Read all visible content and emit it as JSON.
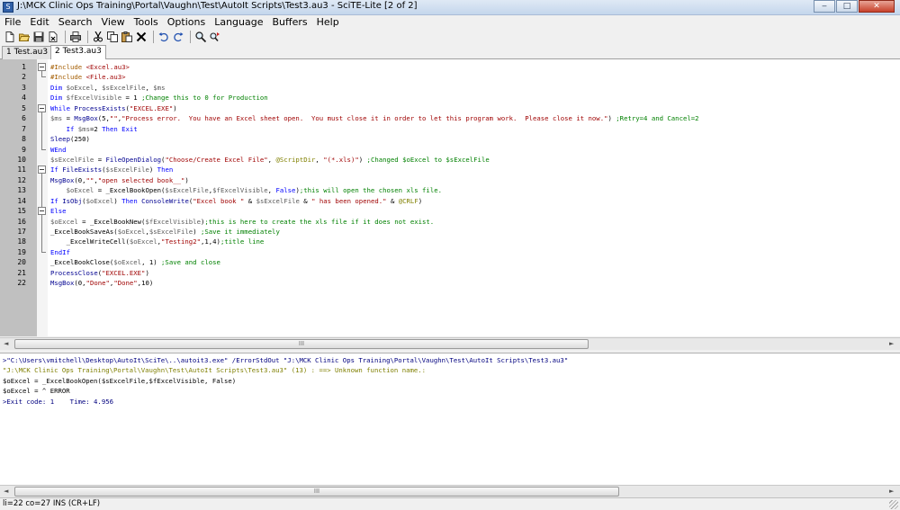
{
  "window": {
    "title": "J:\\MCK Clinic Ops Training\\Portal\\Vaughn\\Test\\AutoIt Scripts\\Test3.au3 - SciTE-Lite [2 of 2]",
    "minimize": "‒",
    "maximize": "□",
    "close": "✕"
  },
  "menu": [
    "File",
    "Edit",
    "Search",
    "View",
    "Tools",
    "Options",
    "Language",
    "Buffers",
    "Help"
  ],
  "toolbar_icons": [
    "new-file-icon",
    "open-folder-icon",
    "save-icon",
    "close-file-icon",
    "print-icon",
    "cut-icon",
    "copy-icon",
    "paste-icon",
    "delete-icon",
    "undo-icon",
    "redo-icon",
    "find-icon",
    "replace-icon"
  ],
  "tabs": [
    {
      "label": "1 Test.au3 *",
      "active": false
    },
    {
      "label": "2 Test3.au3",
      "active": true
    }
  ],
  "colors": {
    "keyword": "#0000ff",
    "string": "#9f0000",
    "comment": "#008000",
    "include": "#a45d00",
    "variable": "#5a5a5a",
    "func": "#000090",
    "macro": "#808000",
    "default": "#000000",
    "out_cmd": "#00007f",
    "out_error": "#7f7f00",
    "out_normal": "#000000"
  },
  "code_lines": [
    {
      "n": "1",
      "fold": "box-start",
      "tokens": [
        [
          "include",
          "#Include"
        ],
        [
          "default",
          " "
        ],
        [
          "string",
          "<Excel.au3>"
        ]
      ]
    },
    {
      "n": "2",
      "fold": "end",
      "tokens": [
        [
          "include",
          "#Include"
        ],
        [
          "default",
          " "
        ],
        [
          "string",
          "<File.au3>"
        ]
      ]
    },
    {
      "n": "3",
      "fold": "",
      "tokens": [
        [
          "keyword",
          "Dim"
        ],
        [
          "default",
          " "
        ],
        [
          "variable",
          "$oExcel"
        ],
        [
          "default",
          ", "
        ],
        [
          "variable",
          "$sExcelFile"
        ],
        [
          "default",
          ", "
        ],
        [
          "variable",
          "$ms"
        ]
      ]
    },
    {
      "n": "4",
      "fold": "",
      "tokens": [
        [
          "keyword",
          "Dim"
        ],
        [
          "default",
          " "
        ],
        [
          "variable",
          "$fExcelVisible"
        ],
        [
          "default",
          " = 1 "
        ],
        [
          "comment",
          ";Change this to 0 for Production"
        ]
      ]
    },
    {
      "n": "5",
      "fold": "box-start",
      "tokens": [
        [
          "keyword",
          "While"
        ],
        [
          "default",
          " "
        ],
        [
          "func",
          "ProcessExists"
        ],
        [
          "default",
          "("
        ],
        [
          "string",
          "\"EXCEL.EXE\""
        ],
        [
          "default",
          ")"
        ]
      ]
    },
    {
      "n": "6",
      "fold": "line",
      "tokens": [
        [
          "variable",
          "$ms"
        ],
        [
          "default",
          " = "
        ],
        [
          "func",
          "MsgBox"
        ],
        [
          "default",
          "(5,"
        ],
        [
          "string",
          "\"\""
        ],
        [
          "default",
          ","
        ],
        [
          "string",
          "\"Process error.  You have an Excel sheet open.  You must close it in order to let this program work.  Please close it now.\""
        ],
        [
          "default",
          ") "
        ],
        [
          "comment",
          ";Retry=4 and Cancel=2"
        ]
      ]
    },
    {
      "n": "7",
      "fold": "line",
      "tokens": [
        [
          "default",
          "    "
        ],
        [
          "keyword",
          "If"
        ],
        [
          "default",
          " "
        ],
        [
          "variable",
          "$ms"
        ],
        [
          "default",
          "=2 "
        ],
        [
          "keyword",
          "Then"
        ],
        [
          "default",
          " "
        ],
        [
          "keyword",
          "Exit"
        ]
      ]
    },
    {
      "n": "8",
      "fold": "line",
      "tokens": [
        [
          "func",
          "Sleep"
        ],
        [
          "default",
          "(250)"
        ]
      ]
    },
    {
      "n": "9",
      "fold": "end",
      "tokens": [
        [
          "keyword",
          "WEnd"
        ]
      ]
    },
    {
      "n": "10",
      "fold": "",
      "tokens": [
        [
          "variable",
          "$sExcelFile"
        ],
        [
          "default",
          " = "
        ],
        [
          "func",
          "FileOpenDialog"
        ],
        [
          "default",
          "("
        ],
        [
          "string",
          "\"Choose/Create Excel File\""
        ],
        [
          "default",
          ", "
        ],
        [
          "macro",
          "@ScriptDir"
        ],
        [
          "default",
          ", "
        ],
        [
          "string",
          "\"(*.xls)\""
        ],
        [
          "default",
          ") "
        ],
        [
          "comment",
          ";Changed $oExcel to $sExcelFile"
        ]
      ]
    },
    {
      "n": "11",
      "fold": "box-start",
      "tokens": [
        [
          "keyword",
          "If"
        ],
        [
          "default",
          " "
        ],
        [
          "func",
          "FileExists"
        ],
        [
          "default",
          "("
        ],
        [
          "variable",
          "$sExcelFile"
        ],
        [
          "default",
          ") "
        ],
        [
          "keyword",
          "Then"
        ]
      ]
    },
    {
      "n": "12",
      "fold": "line",
      "tokens": [
        [
          "func",
          "MsgBox"
        ],
        [
          "default",
          "(0,"
        ],
        [
          "string",
          "\"\""
        ],
        [
          "default",
          ","
        ],
        [
          "string",
          "\"open selected book__\""
        ],
        [
          "default",
          ")"
        ]
      ]
    },
    {
      "n": "13",
      "fold": "line",
      "tokens": [
        [
          "default",
          "    "
        ],
        [
          "variable",
          "$oExcel"
        ],
        [
          "default",
          " = _ExcelBookOpen("
        ],
        [
          "variable",
          "$sExcelFile"
        ],
        [
          "default",
          ","
        ],
        [
          "variable",
          "$fExcelVisible"
        ],
        [
          "default",
          ", "
        ],
        [
          "keyword",
          "False"
        ],
        [
          "default",
          ")"
        ],
        [
          "comment",
          ";this will open the chosen xls file."
        ]
      ]
    },
    {
      "n": "14",
      "fold": "line",
      "tokens": [
        [
          "keyword",
          "If"
        ],
        [
          "default",
          " "
        ],
        [
          "func",
          "IsObj"
        ],
        [
          "default",
          "("
        ],
        [
          "variable",
          "$oExcel"
        ],
        [
          "default",
          ") "
        ],
        [
          "keyword",
          "Then"
        ],
        [
          "default",
          " "
        ],
        [
          "func",
          "ConsoleWrite"
        ],
        [
          "default",
          "("
        ],
        [
          "string",
          "\"Excel book \""
        ],
        [
          "default",
          " & "
        ],
        [
          "variable",
          "$sExcelFile"
        ],
        [
          "default",
          " & "
        ],
        [
          "string",
          "\" has been opened.\""
        ],
        [
          "default",
          " & "
        ],
        [
          "macro",
          "@CRLF"
        ],
        [
          "default",
          ")"
        ]
      ]
    },
    {
      "n": "15",
      "fold": "box-mid",
      "tokens": [
        [
          "keyword",
          "Else"
        ]
      ]
    },
    {
      "n": "16",
      "fold": "line",
      "tokens": [
        [
          "variable",
          "$oExcel"
        ],
        [
          "default",
          " = _ExcelBookNew("
        ],
        [
          "variable",
          "$fExcelVisible"
        ],
        [
          "default",
          ")"
        ],
        [
          "comment",
          ";this is here to create the xls file if it does not exist."
        ]
      ]
    },
    {
      "n": "17",
      "fold": "line",
      "tokens": [
        [
          "default",
          "_ExcelBookSaveAs("
        ],
        [
          "variable",
          "$oExcel"
        ],
        [
          "default",
          ","
        ],
        [
          "variable",
          "$sExcelFile"
        ],
        [
          "default",
          ") "
        ],
        [
          "comment",
          ";Save it immediately"
        ]
      ]
    },
    {
      "n": "18",
      "fold": "line",
      "tokens": [
        [
          "default",
          "    _ExcelWriteCell("
        ],
        [
          "variable",
          "$oExcel"
        ],
        [
          "default",
          ","
        ],
        [
          "string",
          "\"Testing2\""
        ],
        [
          "default",
          ",1,4)"
        ],
        [
          "comment",
          ";title line"
        ]
      ]
    },
    {
      "n": "19",
      "fold": "end",
      "tokens": [
        [
          "keyword",
          "EndIf"
        ]
      ]
    },
    {
      "n": "20",
      "fold": "",
      "tokens": [
        [
          "default",
          "_ExcelBookClose("
        ],
        [
          "variable",
          "$oExcel"
        ],
        [
          "default",
          ", 1) "
        ],
        [
          "comment",
          ";Save and close"
        ]
      ]
    },
    {
      "n": "21",
      "fold": "",
      "tokens": [
        [
          "func",
          "ProcessClose"
        ],
        [
          "default",
          "("
        ],
        [
          "string",
          "\"EXCEL.EXE\""
        ],
        [
          "default",
          ")"
        ]
      ]
    },
    {
      "n": "22",
      "fold": "",
      "tokens": [
        [
          "func",
          "MsgBox"
        ],
        [
          "default",
          "(0,"
        ],
        [
          "string",
          "\"Done\""
        ],
        [
          "default",
          ","
        ],
        [
          "string",
          "\"Done\""
        ],
        [
          "default",
          ",10)"
        ]
      ]
    }
  ],
  "output_lines": [
    {
      "style": "out_cmd",
      "text": ">\"C:\\Users\\vmitchell\\Desktop\\AutoIt\\SciTe\\..\\autoit3.exe\" /ErrorStdOut \"J:\\MCK Clinic Ops Training\\Portal\\Vaughn\\Test\\AutoIt Scripts\\Test3.au3\""
    },
    {
      "style": "out_error",
      "text": "\"J:\\MCK Clinic Ops Training\\Portal\\Vaughn\\Test\\AutoIt Scripts\\Test3.au3\" (13) : ==> Unknown function name.:"
    },
    {
      "style": "out_normal",
      "text": "$oExcel = _ExcelBookOpen($sExcelFile,$fExcelVisible, False)"
    },
    {
      "style": "out_normal",
      "text": "$oExcel = ^ ERROR"
    },
    {
      "style": "out_cmd",
      "text": ">Exit code: 1    Time: 4.956"
    }
  ],
  "scroll": {
    "left_arrow": "◄",
    "right_arrow": "►",
    "thumb_grip": "III"
  },
  "status": "li=22 co=27 INS (CR+LF)"
}
